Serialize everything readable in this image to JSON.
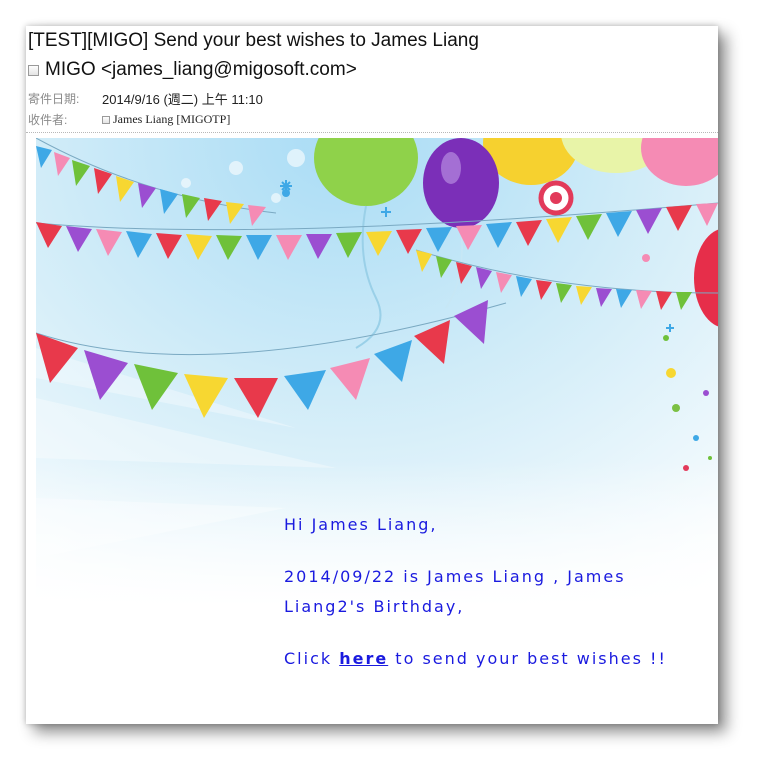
{
  "email": {
    "subject": "[TEST][MIGO] Send your best wishes to James Liang",
    "sender": "MIGO <james_liang@migosoft.com>",
    "date_label": "寄件日期:",
    "date_value": "2014/9/16 (週二) 上午 11:10",
    "recipient_label": "收件者:",
    "recipient_value": "James Liang [MIGOTP]"
  },
  "message": {
    "greeting": "Hi James Liang,",
    "birthday_line": "2014/09/22 is James Liang , James Liang2's Birthday,",
    "cta_prefix": "Click",
    "cta_link": "here",
    "cta_suffix": "to send your best wishes !!"
  },
  "colors": {
    "message_text": "#1a1adf",
    "sky": "#b9e3f7",
    "flags": [
      "#e8394b",
      "#f7d731",
      "#6fc13a",
      "#9b4ed1",
      "#3ea8e6",
      "#f58bb4",
      "#ff8a2a"
    ]
  }
}
